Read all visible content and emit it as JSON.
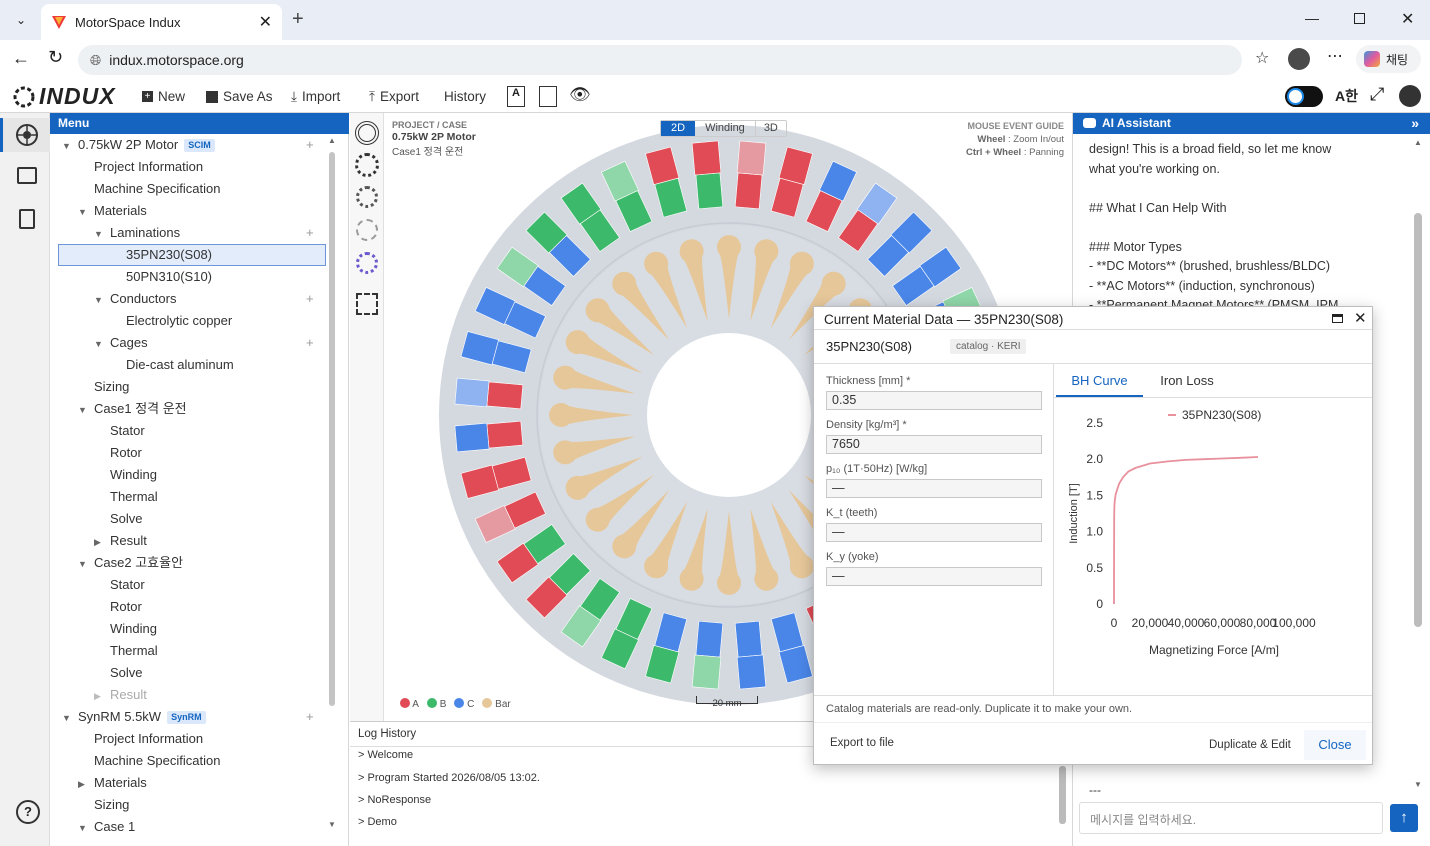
{
  "browser": {
    "tab_title": "MotorSpace Indux",
    "url": "indux.motorspace.org",
    "chat_label": "채팅"
  },
  "app": {
    "logo": "INDUX",
    "toolbar": {
      "new": "New",
      "save_as": "Save As",
      "import": "Import",
      "export": "Export",
      "history": "History"
    }
  },
  "menu": {
    "header": "Menu",
    "items": [
      {
        "label": "0.75kW 2P Motor",
        "badge": "SCIM"
      },
      {
        "label": "Project Information"
      },
      {
        "label": "Machine Specification"
      },
      {
        "label": "Materials"
      },
      {
        "label": "Laminations"
      },
      {
        "label": "35PN230(S08)"
      },
      {
        "label": "50PN310(S10)"
      },
      {
        "label": "Conductors"
      },
      {
        "label": "Electrolytic copper"
      },
      {
        "label": "Cages"
      },
      {
        "label": "Die-cast aluminum"
      },
      {
        "label": "Sizing"
      },
      {
        "label": "Case1 정격 운전"
      },
      {
        "label": "Stator"
      },
      {
        "label": "Rotor"
      },
      {
        "label": "Winding"
      },
      {
        "label": "Thermal"
      },
      {
        "label": "Solve"
      },
      {
        "label": "Result"
      },
      {
        "label": "Case2 고효율안"
      },
      {
        "label": "Stator"
      },
      {
        "label": "Rotor"
      },
      {
        "label": "Winding"
      },
      {
        "label": "Thermal"
      },
      {
        "label": "Solve"
      },
      {
        "label": "Result"
      },
      {
        "label": "SynRM 5.5kW",
        "badge": "SynRM"
      },
      {
        "label": "Project Information"
      },
      {
        "label": "Machine Specification"
      },
      {
        "label": "Materials"
      },
      {
        "label": "Sizing"
      },
      {
        "label": "Case 1"
      }
    ]
  },
  "view": {
    "section": "PROJECT / CASE",
    "project": "0.75kW 2P Motor",
    "case": "Case1 정격 운전",
    "tabs": [
      "2D",
      "Winding",
      "3D"
    ],
    "active_tab": "2D",
    "guide_title": "MOUSE EVENT GUIDE",
    "guide_wheel_key": "Wheel",
    "guide_wheel": " : Zoom In/out",
    "guide_pan_key": "Ctrl + Wheel",
    "guide_pan": " : Panning",
    "legend": [
      {
        "label": "A",
        "color": "#e04b55"
      },
      {
        "label": "B",
        "color": "#3cb96a"
      },
      {
        "label": "C",
        "color": "#4a86e8"
      },
      {
        "label": "Bar",
        "color": "#e6c79a"
      }
    ],
    "scale": "20 mm"
  },
  "log": {
    "title": "Log History",
    "lines": [
      "> Welcome",
      "> Program Started  2026/08/05 13:02.",
      "> NoResponse",
      "> Demo"
    ]
  },
  "assistant": {
    "title": "AI Assistant",
    "lines": [
      "design! This is a broad field, so let me know",
      "what you're working on.",
      "",
      "## What I Can Help With",
      "",
      "### Motor Types",
      "- **DC Motors** (brushed, brushless/BLDC)",
      "- **AC Motors** (induction, synchronous)",
      "- **Permanent Magnet Motors** (PMSM, IPM"
    ],
    "tail": "---",
    "input_placeholder": "메시지를 입력하세요."
  },
  "modal": {
    "title": "Current Material Data — 35PN230(S08)",
    "name": "35PN230(S08)",
    "catalog": "catalog · KERI",
    "fields": [
      {
        "label": "Thickness [mm] *",
        "value": "0.35"
      },
      {
        "label": "Density [kg/m³] *",
        "value": "7650"
      },
      {
        "label": "p₁₀ (1T·50Hz) [W/kg]",
        "value": "—"
      },
      {
        "label": "K_t (teeth)",
        "value": "—"
      },
      {
        "label": "K_y (yoke)",
        "value": "—"
      }
    ],
    "tabs": [
      "BH Curve",
      "Iron Loss"
    ],
    "active_tab": "BH Curve",
    "note": "Catalog materials are read-only. Duplicate it to make your own.",
    "export": "Export to file",
    "duplicate": "Duplicate & Edit",
    "close": "Close"
  },
  "chart_data": {
    "type": "line",
    "series": [
      {
        "name": "35PN230(S08)",
        "color": "#e8909c",
        "x": [
          0,
          20,
          50,
          100,
          200,
          400,
          700,
          1000,
          2000,
          3000,
          5000,
          8000,
          12000,
          20000,
          30000,
          40000,
          50000,
          60000,
          70000,
          80000
        ],
        "y": [
          0,
          0.3,
          0.8,
          1.2,
          1.35,
          1.42,
          1.48,
          1.52,
          1.6,
          1.67,
          1.75,
          1.83,
          1.88,
          1.94,
          1.97,
          1.99,
          2.0,
          2.01,
          2.02,
          2.03
        ]
      }
    ],
    "xlabel": "Magnetizing Force [A/m]",
    "ylabel": "Induction [T]",
    "xlim": [
      0,
      100000
    ],
    "ylim": [
      0,
      2.5
    ],
    "xticks": [
      "0",
      "20,000",
      "40,000",
      "60,000",
      "80,000",
      "100,000"
    ],
    "yticks": [
      "0",
      "0.5",
      "1.0",
      "1.5",
      "2.0",
      "2.5"
    ],
    "legend": "top-center",
    "grid": false
  }
}
